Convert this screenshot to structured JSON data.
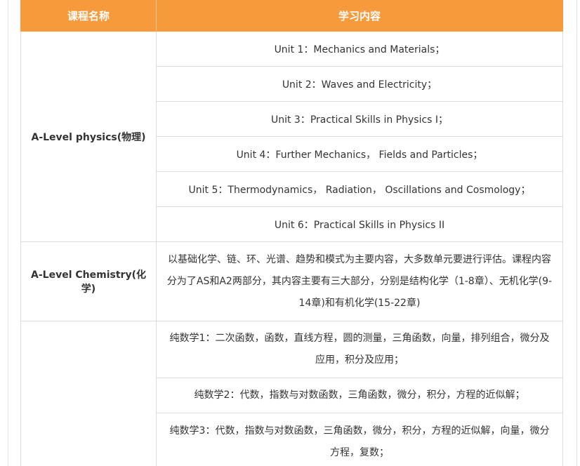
{
  "table": {
    "headers": {
      "course_name": "课程名称",
      "content": "学习内容"
    },
    "physics": {
      "name": "A-Level physics(物理)",
      "units": [
        "Unit 1：Mechanics and Materials；",
        "Unit 2：Waves and Electricity；",
        "Unit 3：Practical Skills in Physics I；",
        "Unit 4：Further Mechanics， Fields and Particles；",
        "Unit 5：Thermodynamics， Radiation， Oscillations and Cosmology；",
        "Unit 6：Practical Skills in Physics II"
      ]
    },
    "chemistry": {
      "name": "A-Level Chemistry(化学)",
      "content": "以基础化学、链、环、光谱、趋势和模式为主要内容，大多数单元要进行评估。课程内容分为了AS和A2两部分，其内容主要有三大部分，分别是结构化学（1-8章）、无机化学(9-14章)和有机化学(15-22章)"
    },
    "maths": {
      "name": "",
      "items": [
        "纯数学1：二次函数，函数，直线方程，圆的测量，三角函数，向量，排列组合，微分及应用，积分及应用；",
        "纯数学2：代数，指数与对数函数，三角函数，微分，积分，方程的近似解；",
        "纯数学3：代数，指数与对数函数，三角函数，微分，积分，方程的近似解，向量，微分方程，复数；"
      ]
    }
  },
  "colors": {
    "header_bg": "#f79a3b",
    "header_text": "#ffffff",
    "border": "#dcdcdc",
    "text": "#333333"
  }
}
